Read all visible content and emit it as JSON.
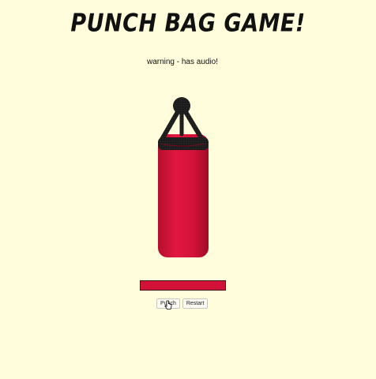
{
  "game": {
    "title": "PUNCH BAG GAME!",
    "warning": "warning - has audio!"
  },
  "health": {
    "fraction": 1.0,
    "color": "#D3123A"
  },
  "controls": {
    "punch_label": "Punch",
    "restart_label": "Restart"
  },
  "colors": {
    "background": "#FFFDDB",
    "bag": "#D3123A",
    "chain": "#1a1a1a"
  },
  "icons": {
    "cursor": "hand-pointer-icon"
  }
}
